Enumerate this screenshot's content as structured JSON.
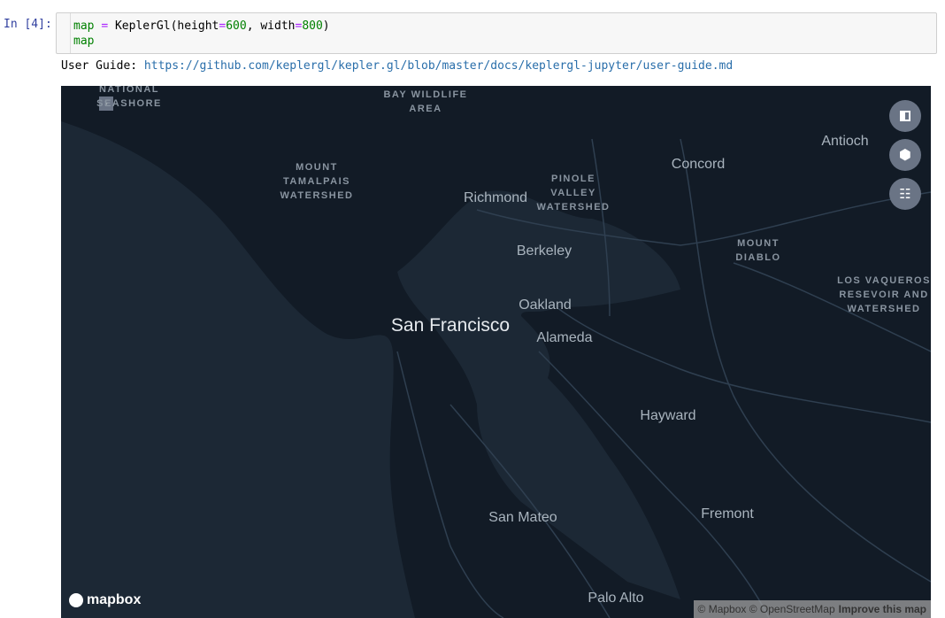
{
  "cell": {
    "prompt": "In [4]:",
    "code_line1": {
      "var": "map",
      "op": "=",
      "call": "KeplerGl(height",
      "eq1": "=",
      "h": "600",
      "sep": ", width",
      "eq2": "=",
      "w": "800",
      "close": ")"
    },
    "code_line2": "map"
  },
  "output": {
    "guide_label": "User Guide: ",
    "guide_url": "https://github.com/keplergl/kepler.gl/blob/master/docs/keplergl-jupyter/user-guide.md"
  },
  "map": {
    "labels": {
      "national_seashore_1": "NATIONAL",
      "national_seashore_2": "SEASHORE",
      "bay_wildlife_1": "BAY WILDLIFE",
      "bay_wildlife_2": "AREA",
      "tamalpais_1": "MOUNT",
      "tamalpais_2": "TAMALPAIS",
      "tamalpais_3": "WATERSHED",
      "pinole_1": "PINOLE",
      "pinole_2": "VALLEY",
      "pinole_3": "WATERSHED",
      "diablo_1": "MOUNT",
      "diablo_2": "DIABLO",
      "vaqueros_1": "LOS VAQUEROS",
      "vaqueros_2": "RESEVOIR AND",
      "vaqueros_3": "WATERSHED",
      "antioch": "Antioch",
      "concord": "Concord",
      "richmond": "Richmond",
      "berkeley": "Berkeley",
      "oakland": "Oakland",
      "san_francisco": "San Francisco",
      "alameda": "Alameda",
      "hayward": "Hayward",
      "san_mateo": "San Mateo",
      "fremont": "Fremont",
      "palo_alto": "Palo Alto"
    },
    "controls": [
      "split-map",
      "3d-view",
      "data-table"
    ],
    "logo": "mapbox",
    "attribution": {
      "mapbox": "© Mapbox",
      "osm": "© OpenStreetMap",
      "improve": "Improve this map"
    }
  }
}
